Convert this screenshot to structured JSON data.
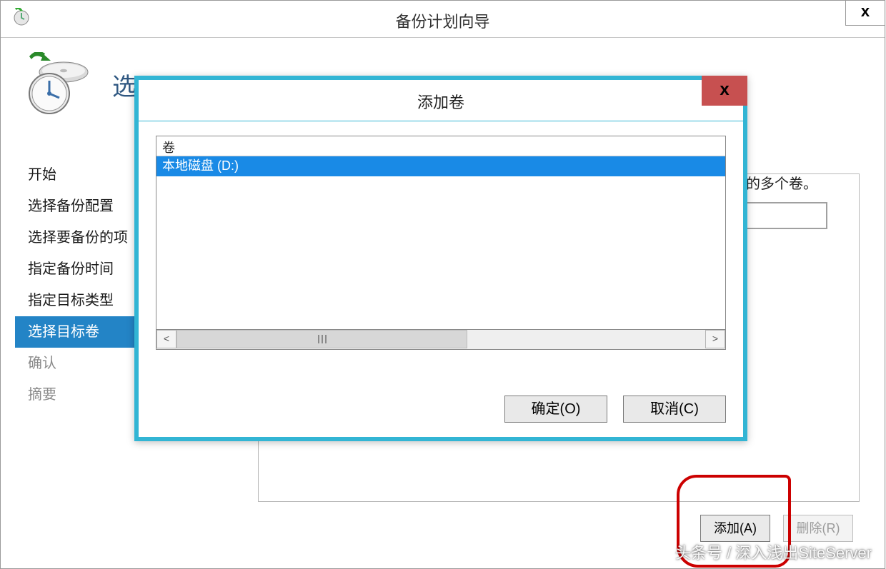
{
  "wizard": {
    "title": "备份计划向导",
    "close_label": "x",
    "step_title": "选",
    "right_text": "中的多个卷。",
    "steps": [
      {
        "label": "开始",
        "active": false,
        "muted": false
      },
      {
        "label": "选择备份配置",
        "active": false,
        "muted": false
      },
      {
        "label": "选择要备份的项",
        "active": false,
        "muted": false
      },
      {
        "label": "指定备份时间",
        "active": false,
        "muted": false
      },
      {
        "label": "指定目标类型",
        "active": false,
        "muted": false
      },
      {
        "label": "选择目标卷",
        "active": true,
        "muted": false
      },
      {
        "label": "确认",
        "active": false,
        "muted": true
      },
      {
        "label": "摘要",
        "active": false,
        "muted": true
      }
    ],
    "buttons": {
      "add": "添加(A)",
      "remove": "删除(R)"
    }
  },
  "modal": {
    "title": "添加卷",
    "close_label": "x",
    "list_header": "卷",
    "items": [
      {
        "label": "本地磁盘 (D:)",
        "selected": true
      }
    ],
    "buttons": {
      "ok": "确定(O)",
      "cancel": "取消(C)"
    },
    "scroll": {
      "left": "<",
      "right": ">"
    }
  },
  "watermark": "头条号 / 深入浅出SiteServer"
}
